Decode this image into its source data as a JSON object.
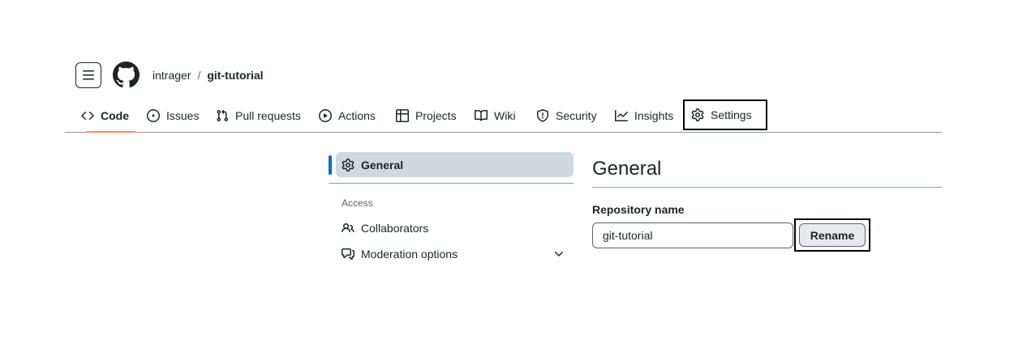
{
  "header": {
    "menu_icon": "three-bars-icon",
    "logo_icon": "github-mark-icon",
    "owner": "intrager",
    "separator": "/",
    "repo": "git-tutorial"
  },
  "tabs": [
    {
      "label": "Code",
      "icon": "code-icon",
      "active": true
    },
    {
      "label": "Issues",
      "icon": "issue-opened-icon"
    },
    {
      "label": "Pull requests",
      "icon": "git-pull-request-icon"
    },
    {
      "label": "Actions",
      "icon": "play-icon"
    },
    {
      "label": "Projects",
      "icon": "table-icon"
    },
    {
      "label": "Wiki",
      "icon": "book-icon"
    },
    {
      "label": "Security",
      "icon": "shield-icon"
    },
    {
      "label": "Insights",
      "icon": "graph-icon"
    },
    {
      "label": "Settings",
      "icon": "gear-icon",
      "highlighted": true
    }
  ],
  "sidebar": {
    "active_item": {
      "label": "General",
      "icon": "gear-icon"
    },
    "section_heading": "Access",
    "items": [
      {
        "label": "Collaborators",
        "icon": "people-icon"
      },
      {
        "label": "Moderation options",
        "icon": "comment-discussion-icon",
        "expandable": true
      }
    ]
  },
  "main": {
    "title": "General",
    "repo_name_label": "Repository name",
    "repo_name_value": "git-tutorial",
    "rename_button": "Rename"
  },
  "colors": {
    "text": "#1f2328",
    "muted": "#59636e",
    "border": "#9198a1",
    "active_tab_underline": "#fd8c73",
    "sidebar_active_bg": "#d1d9e0",
    "sidebar_active_bar": "#0969da",
    "button_bg": "#e6eaef"
  }
}
